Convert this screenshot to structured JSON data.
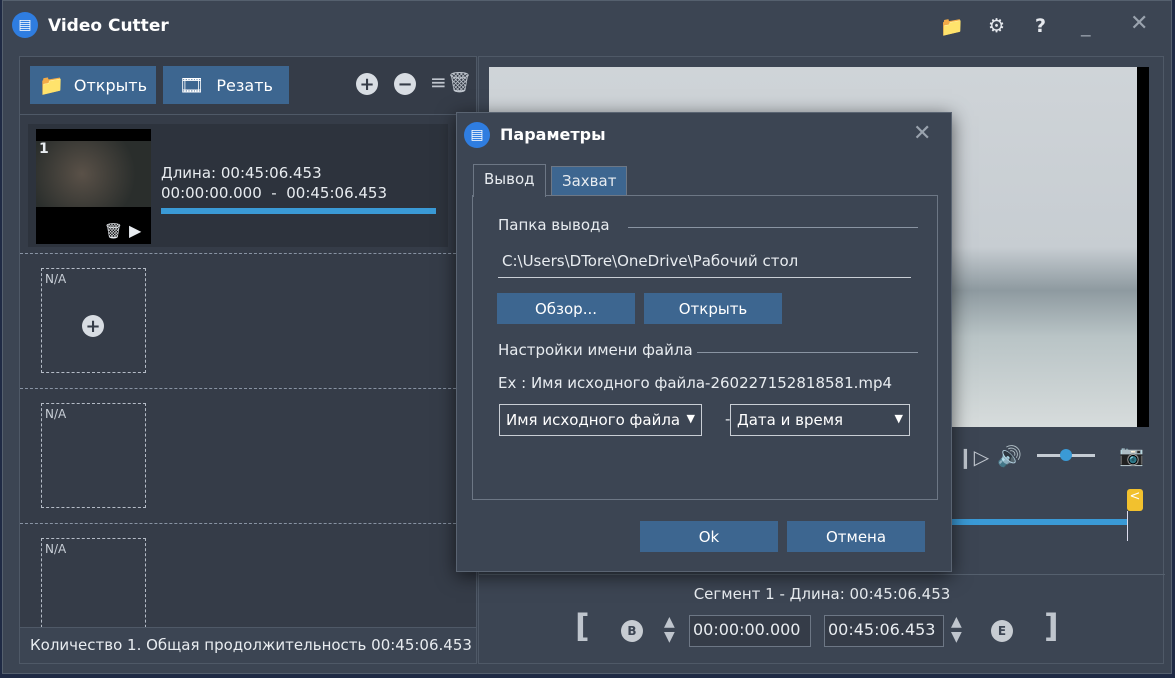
{
  "window": {
    "title": "Video Cutter",
    "logo": "film-logo",
    "icons": [
      "folder-icon",
      "gear-icon",
      "help-icon",
      "minimize-icon",
      "close-icon"
    ]
  },
  "toolbar": {
    "open_label": "Открыть",
    "cut_label": "Резать"
  },
  "clips": [
    {
      "index": "1",
      "length": "Длина: 00:45:06.453",
      "range": "00:00:00.000  -  00:45:06.453",
      "progress": 1.0
    }
  ],
  "empty_slots": [
    "N/A",
    "N/A",
    "N/A"
  ],
  "status": "Количество 1. Общая продолжительность 00:45:06.453",
  "player": {
    "volume": 0.5
  },
  "segment": {
    "label": "Сегмент 1 - Длина: 00:45:06.453",
    "start": "00:00:00.000",
    "end": "00:45:06.453",
    "begin_marker": "B",
    "end_marker": "E",
    "left_bracket": "[",
    "right_bracket": "]"
  },
  "dialog": {
    "title": "Параметры",
    "tabs": [
      {
        "label": "Вывод",
        "active": true
      },
      {
        "label": "Захват",
        "active": false
      }
    ],
    "output_folder_label": "Папка вывода",
    "output_path": "C:\\Users\\DTore\\OneDrive\\Рабочий стол",
    "browse_label": "Обзор...",
    "open_label": "Открыть",
    "filename_settings_label": "Настройки имени файла",
    "example": "Ex : Имя исходного файла-260227152818581.mp4",
    "name_part1": "Имя исходного файла",
    "separator": "-",
    "name_part2": "Дата и время",
    "ok_label": "Ok",
    "cancel_label": "Отмена"
  },
  "colors": {
    "accent": "#3d6690",
    "progress": "#3a9ad6",
    "marker": "#f2c12e"
  }
}
